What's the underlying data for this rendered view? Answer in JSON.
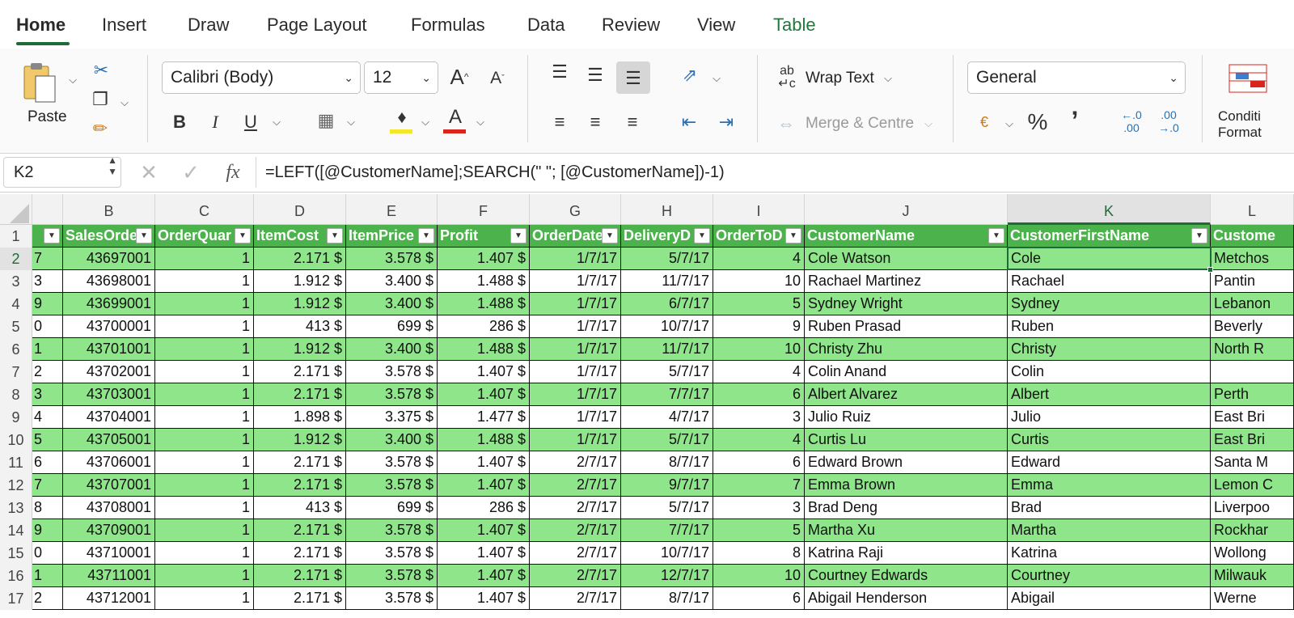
{
  "ribbon_tabs": [
    "Home",
    "Insert",
    "Draw",
    "Page Layout",
    "Formulas",
    "Data",
    "Review",
    "View",
    "Table"
  ],
  "clipboard": {
    "paste_label": "Paste"
  },
  "font": {
    "family": "Calibri (Body)",
    "size": "12"
  },
  "alignment": {
    "wrap_text": "Wrap Text",
    "merge_centre": "Merge & Centre"
  },
  "number": {
    "format": "General"
  },
  "styles": {
    "conditional_formatting": "Conditi\nFormat"
  },
  "formula_bar": {
    "cell_ref": "K2",
    "formula": "=LEFT([@CustomerName];SEARCH(\" \"; [@CustomerName])-1)"
  },
  "columns": [
    "B",
    "C",
    "D",
    "E",
    "F",
    "G",
    "H",
    "I",
    "J",
    "K",
    "L"
  ],
  "headers": [
    "SalesOrde",
    "OrderQuar",
    "ItemCost",
    "ItemPrice",
    "Profit",
    "OrderDate",
    "DeliveryD",
    "OrderToD",
    "CustomerName",
    "CustomerFirstName",
    "Custome"
  ],
  "row_numbers": [
    "1",
    "2",
    "3",
    "4",
    "5",
    "6",
    "7",
    "8",
    "9",
    "10",
    "11",
    "12",
    "13",
    "14",
    "15",
    "16",
    "17"
  ],
  "rows": [
    [
      "7",
      "43697001",
      "1",
      "2.171 $",
      "3.578 $",
      "1.407 $",
      "1/7/17",
      "5/7/17",
      "4",
      "Cole Watson",
      "Cole",
      "Metchos"
    ],
    [
      "3",
      "43698001",
      "1",
      "1.912 $",
      "3.400 $",
      "1.488 $",
      "1/7/17",
      "11/7/17",
      "10",
      "Rachael Martinez",
      "Rachael",
      "Pantin"
    ],
    [
      "9",
      "43699001",
      "1",
      "1.912 $",
      "3.400 $",
      "1.488 $",
      "1/7/17",
      "6/7/17",
      "5",
      "Sydney Wright",
      "Sydney",
      "Lebanon"
    ],
    [
      "0",
      "43700001",
      "1",
      "413 $",
      "699 $",
      "286 $",
      "1/7/17",
      "10/7/17",
      "9",
      "Ruben Prasad",
      "Ruben",
      "Beverly"
    ],
    [
      "1",
      "43701001",
      "1",
      "1.912 $",
      "3.400 $",
      "1.488 $",
      "1/7/17",
      "11/7/17",
      "10",
      "Christy Zhu",
      "Christy",
      "North R"
    ],
    [
      "2",
      "43702001",
      "1",
      "2.171 $",
      "3.578 $",
      "1.407 $",
      "1/7/17",
      "5/7/17",
      "4",
      "Colin Anand",
      "Colin",
      ""
    ],
    [
      "3",
      "43703001",
      "1",
      "2.171 $",
      "3.578 $",
      "1.407 $",
      "1/7/17",
      "7/7/17",
      "6",
      "Albert Alvarez",
      "Albert",
      "Perth"
    ],
    [
      "4",
      "43704001",
      "1",
      "1.898 $",
      "3.375 $",
      "1.477 $",
      "1/7/17",
      "4/7/17",
      "3",
      "Julio Ruiz",
      "Julio",
      "East Bri"
    ],
    [
      "5",
      "43705001",
      "1",
      "1.912 $",
      "3.400 $",
      "1.488 $",
      "1/7/17",
      "5/7/17",
      "4",
      "Curtis Lu",
      "Curtis",
      "East Bri"
    ],
    [
      "6",
      "43706001",
      "1",
      "2.171 $",
      "3.578 $",
      "1.407 $",
      "2/7/17",
      "8/7/17",
      "6",
      "Edward Brown",
      "Edward",
      "Santa M"
    ],
    [
      "7",
      "43707001",
      "1",
      "2.171 $",
      "3.578 $",
      "1.407 $",
      "2/7/17",
      "9/7/17",
      "7",
      "Emma Brown",
      "Emma",
      "Lemon C"
    ],
    [
      "8",
      "43708001",
      "1",
      "413 $",
      "699 $",
      "286 $",
      "2/7/17",
      "5/7/17",
      "3",
      "Brad Deng",
      "Brad",
      "Liverpoo"
    ],
    [
      "9",
      "43709001",
      "1",
      "2.171 $",
      "3.578 $",
      "1.407 $",
      "2/7/17",
      "7/7/17",
      "5",
      "Martha Xu",
      "Martha",
      "Rockhar"
    ],
    [
      "0",
      "43710001",
      "1",
      "2.171 $",
      "3.578 $",
      "1.407 $",
      "2/7/17",
      "10/7/17",
      "8",
      "Katrina Raji",
      "Katrina",
      "Wollong"
    ],
    [
      "1",
      "43711001",
      "1",
      "2.171 $",
      "3.578 $",
      "1.407 $",
      "2/7/17",
      "12/7/17",
      "10",
      "Courtney Edwards",
      "Courtney",
      "Milwauk"
    ],
    [
      "2",
      "43712001",
      "1",
      "2.171 $",
      "3.578 $",
      "1.407 $",
      "2/7/17",
      "8/7/17",
      "6",
      "Abigail Henderson",
      "Abigail",
      "Werne"
    ]
  ],
  "colors": {
    "header_green": "#4cb34c",
    "band_green": "#8fe58a",
    "accent": "#1e6b38"
  }
}
